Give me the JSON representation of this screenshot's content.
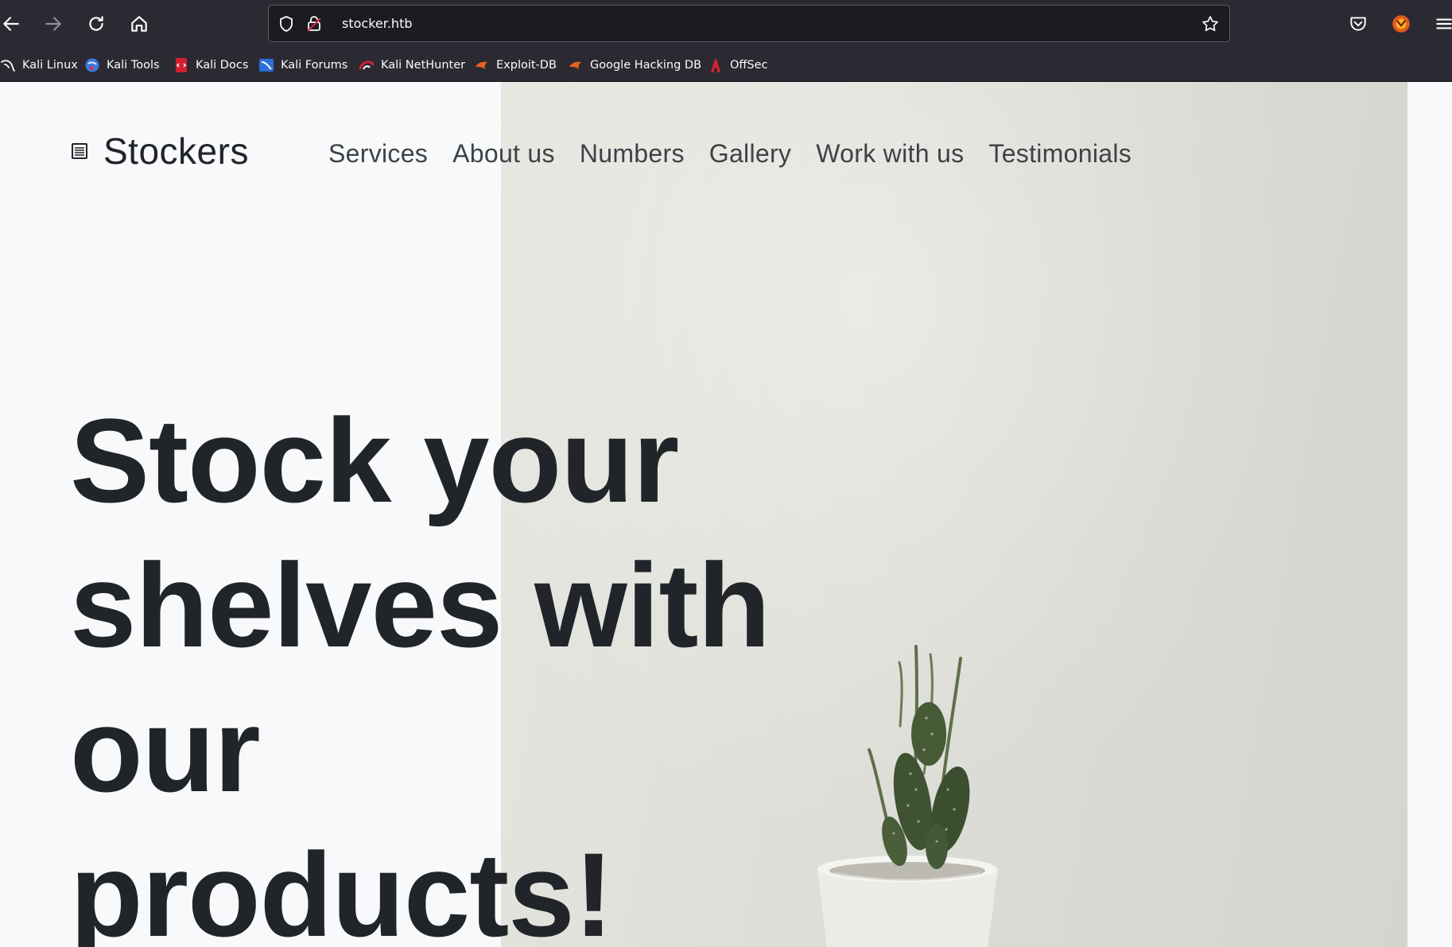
{
  "browser": {
    "url": "stocker.htb",
    "icons": [
      "back-icon",
      "forward-icon",
      "reload-icon",
      "home-icon",
      "shield-icon",
      "lock-icon",
      "star-icon",
      "pocket-icon",
      "account-icon",
      "menu-icon"
    ],
    "bookmarks": [
      {
        "label": "Kali Linux",
        "icon": "kali-dragon-icon"
      },
      {
        "label": "Kali Tools",
        "icon": "kali-tools-icon"
      },
      {
        "label": "Kali Docs",
        "icon": "kali-docs-icon"
      },
      {
        "label": "Kali Forums",
        "icon": "kali-forums-icon"
      },
      {
        "label": "Kali NetHunter",
        "icon": "kali-nethunter-icon"
      },
      {
        "label": "Exploit-DB",
        "icon": "exploit-db-icon"
      },
      {
        "label": "Google Hacking DB",
        "icon": "ghdb-icon"
      },
      {
        "label": "OffSec",
        "icon": "offsec-icon"
      }
    ]
  },
  "site": {
    "brand": "Stockers",
    "brand_icon": "newspaper-icon",
    "nav": [
      "Services",
      "About us",
      "Numbers",
      "Gallery",
      "Work with us",
      "Testimonials"
    ],
    "hero_lines": [
      "Stock your",
      "shelves with",
      "our",
      "products!"
    ]
  },
  "colors": {
    "chrome_bg": "#2b2a33",
    "urlbar_bg": "#1c1b22",
    "page_bg": "#f8f9fa",
    "text_dark": "#212529",
    "nav_text": "#3d4246"
  }
}
